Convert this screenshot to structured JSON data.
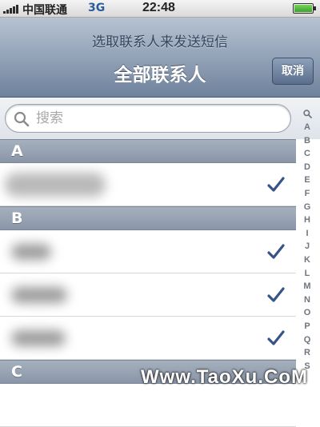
{
  "status_bar": {
    "carrier": "中国联通",
    "network": "3G",
    "time": "22:48",
    "battery_level": 1.0
  },
  "nav_bar": {
    "prompt": "选取联系人来发送短信",
    "title": "全部联系人",
    "cancel_label": "取消"
  },
  "search": {
    "placeholder": "搜索",
    "value": ""
  },
  "sections": [
    {
      "letter": "A",
      "contacts": [
        {
          "name": "",
          "checked": true
        }
      ]
    },
    {
      "letter": "B",
      "contacts": [
        {
          "name": "",
          "checked": true
        },
        {
          "name": "",
          "checked": true
        },
        {
          "name": "",
          "checked": true
        }
      ]
    },
    {
      "letter": "C",
      "contacts": []
    }
  ],
  "index_letters": [
    "A",
    "B",
    "C",
    "D",
    "E",
    "F",
    "G",
    "H",
    "I",
    "J",
    "K",
    "L",
    "M",
    "N",
    "O",
    "P",
    "Q",
    "R",
    "S"
  ],
  "watermark": "Www.TaoXu.CoM",
  "colors": {
    "nav_top": "#b7c3d2",
    "nav_bottom": "#6f829c",
    "section_header": "#8996a8",
    "checkmark": "#385487"
  }
}
